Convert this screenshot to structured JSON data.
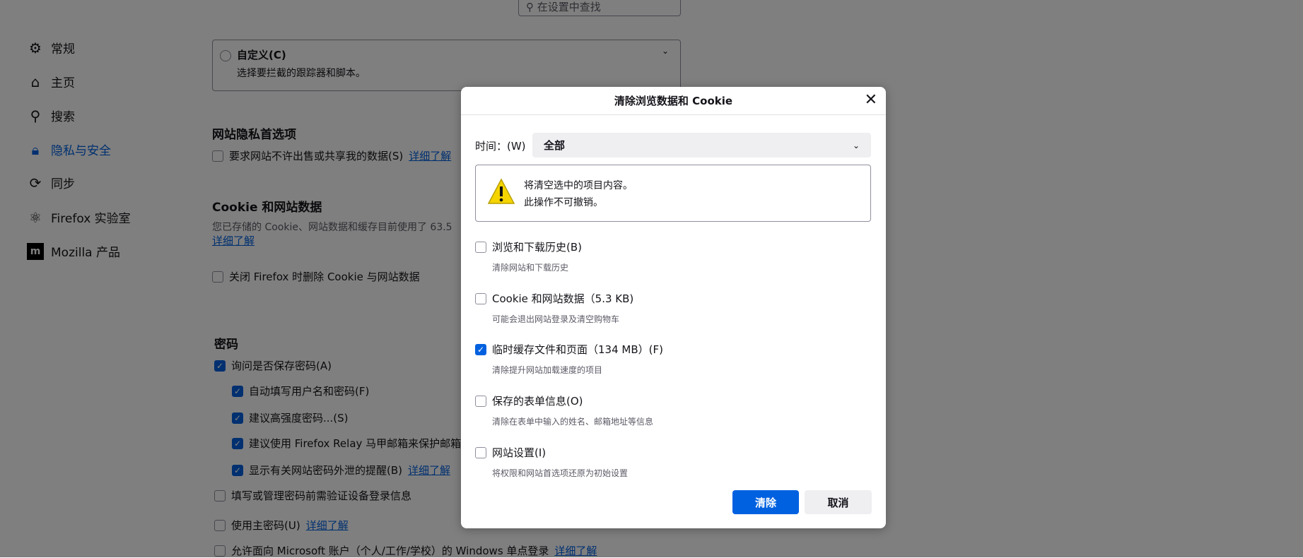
{
  "search": {
    "placeholder": "在设置中查找"
  },
  "sidebar": {
    "items": [
      {
        "label": "常规",
        "icon": "gear-icon"
      },
      {
        "label": "主页",
        "icon": "home-icon"
      },
      {
        "label": "搜索",
        "icon": "search-icon"
      },
      {
        "label": "隐私与安全",
        "icon": "lock-icon",
        "selected": true
      },
      {
        "label": "同步",
        "icon": "sync-icon"
      },
      {
        "label": "Firefox 实验室",
        "icon": "flask-icon"
      },
      {
        "label": "Mozilla 产品",
        "icon": "mozilla-icon"
      }
    ]
  },
  "tracking": {
    "custom_label": "自定义(C)",
    "custom_desc": "选择要拦截的跟踪器和脚本。"
  },
  "privacy_prefs": {
    "heading": "网站隐私首选项",
    "dnt_label": "要求网站不许出售或共享我的数据(S)",
    "learn_more": "详细了解"
  },
  "cookies": {
    "heading": "Cookie 和网站数据",
    "desc": "您已存储的 Cookie、网站数据和缓存目前使用了 63.5",
    "learn_more": "详细了解",
    "delete_on_close": "关闭 Firefox 时删除 Cookie 与网站数据"
  },
  "passwords": {
    "heading": "密码",
    "ask_save": "询问是否保存密码(A)",
    "autofill": "自动填写用户名和密码(F)",
    "suggest_strong": "建议高强度密码...(S)",
    "relay": "建议使用 Firefox Relay 马甲邮箱来保护邮箱地",
    "breach": "显示有关网站密码外泄的提醒(B)",
    "breach_learn": "详细了解",
    "require_auth": "填写或管理密码前需验证设备登录信息",
    "primary": "使用主密码(U)",
    "primary_learn": "详细了解",
    "sso": "允许面向 Microsoft 账户（个人/工作/学校）的 Windows 单点登录",
    "sso_learn": "详细了解"
  },
  "dialog": {
    "title": "清除浏览数据和 Cookie",
    "time_label": "时间：(W)",
    "time_value": "全部",
    "warning_line1": "将清空选中的项目内容。",
    "warning_line2": "此操作不可撤销。",
    "items": [
      {
        "label": "浏览和下载历史(B)",
        "desc": "清除网站和下载历史",
        "checked": false
      },
      {
        "label": "Cookie 和网站数据（5.3 KB)",
        "desc": "可能会退出网站登录及清空购物车",
        "checked": false
      },
      {
        "label": "临时缓存文件和页面（134 MB）(F)",
        "desc": "清除提升网站加载速度的项目",
        "checked": true
      },
      {
        "label": "保存的表单信息(O)",
        "desc": "清除在表单中输入的姓名、邮箱地址等信息",
        "checked": false
      },
      {
        "label": "网站设置(I)",
        "desc": "将权限和网站首选项还原为初始设置",
        "checked": false
      }
    ],
    "clear_button": "清除",
    "cancel_button": "取消"
  },
  "colors": {
    "accent": "#0061e0",
    "overlay": "rgba(0,0,0,0.5)"
  }
}
